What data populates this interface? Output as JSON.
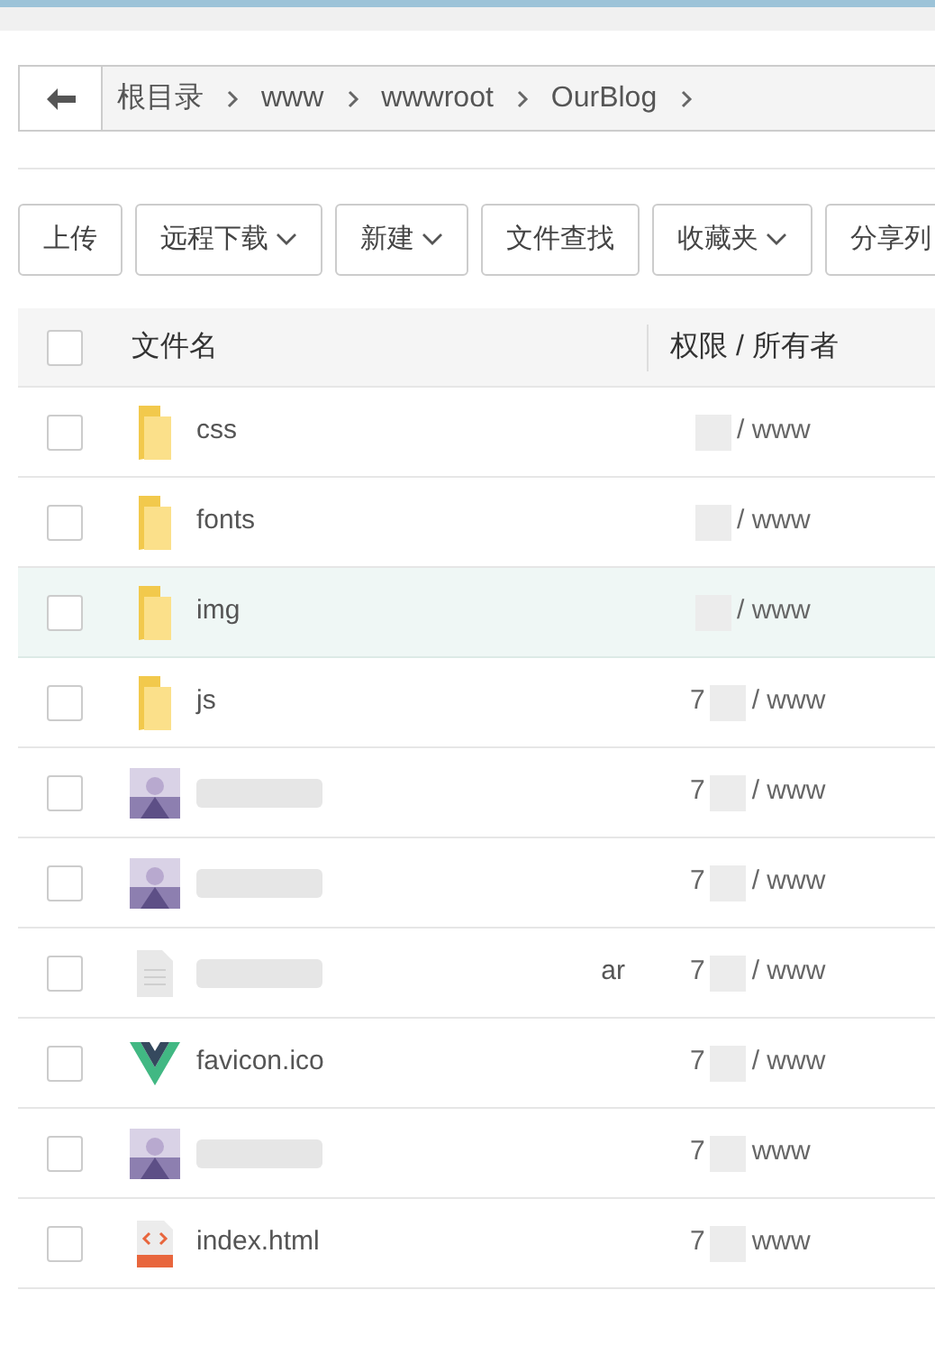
{
  "breadcrumb": [
    "根目录",
    "www",
    "wwwroot",
    "OurBlog"
  ],
  "toolbar": [
    {
      "label": "上传",
      "dropdown": false
    },
    {
      "label": "远程下载",
      "dropdown": true
    },
    {
      "label": "新建",
      "dropdown": true
    },
    {
      "label": "文件查找",
      "dropdown": false
    },
    {
      "label": "收藏夹",
      "dropdown": true
    },
    {
      "label": "分享列",
      "dropdown": false
    }
  ],
  "table": {
    "columns": [
      "文件名",
      "权限 / 所有者"
    ],
    "select_all": false,
    "rows": [
      {
        "kind": "folder",
        "name": "css",
        "permissions": "/ www",
        "checked": false,
        "highlighted": false
      },
      {
        "kind": "folder",
        "name": "fonts",
        "permissions": "/ www",
        "checked": false,
        "highlighted": false
      },
      {
        "kind": "folder",
        "name": "img",
        "permissions": "/ www",
        "checked": false,
        "highlighted": true
      },
      {
        "kind": "folder",
        "name": "js",
        "permissions": "7",
        "permissions_2": "/ www",
        "checked": false,
        "highlighted": false
      },
      {
        "kind": "picture",
        "permissions": "7",
        "permissions_2": "/ www",
        "checked": false,
        "highlighted": false
      },
      {
        "kind": "picture",
        "permissions": "7",
        "permissions_2": "/ www",
        "checked": false,
        "highlighted": false
      },
      {
        "kind": "file",
        "name_end": "ar",
        "permissions": "7",
        "permissions_2": "/ www",
        "checked": false,
        "highlighted": false
      },
      {
        "kind": "vue",
        "name": "favicon.ico",
        "permissions": "7",
        "permissions_2": "/ www",
        "checked": false,
        "highlighted": false
      },
      {
        "kind": "picture",
        "permissions": "7",
        "permissions_2": "www",
        "checked": false,
        "highlighted": false
      },
      {
        "kind": "html",
        "name": "index.html",
        "permissions": "7",
        "permissions_2": "www",
        "checked": false,
        "highlighted": false
      }
    ]
  }
}
